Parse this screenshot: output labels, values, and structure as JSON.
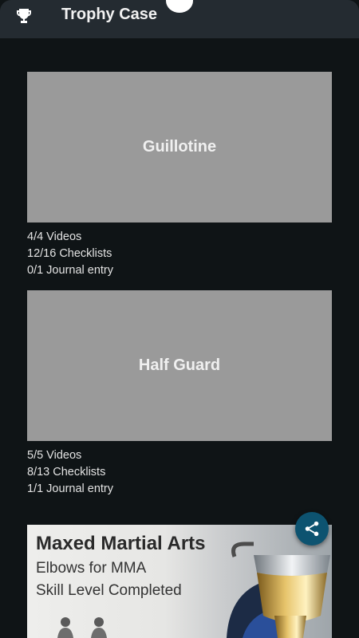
{
  "header": {
    "title": "Trophy Case",
    "icon": "trophy-icon"
  },
  "trophies": [
    {
      "name": "Guillotine",
      "videos": "4/4 Videos",
      "checklists": "12/16 Checklists",
      "journal": "0/1 Journal entry"
    },
    {
      "name": "Half Guard",
      "videos": "5/5 Videos",
      "checklists": "8/13 Checklists",
      "journal": "1/1 Journal entry"
    }
  ],
  "promo": {
    "title": "Maxed Martial Arts",
    "line1": "Elbows for MMA",
    "line2": "Skill Level Completed"
  },
  "fab": {
    "icon": "share-icon"
  },
  "colors": {
    "background": "#0f1416",
    "appbar": "#242b31",
    "card_placeholder": "#9a9a9a",
    "fab": "#0d5370"
  }
}
